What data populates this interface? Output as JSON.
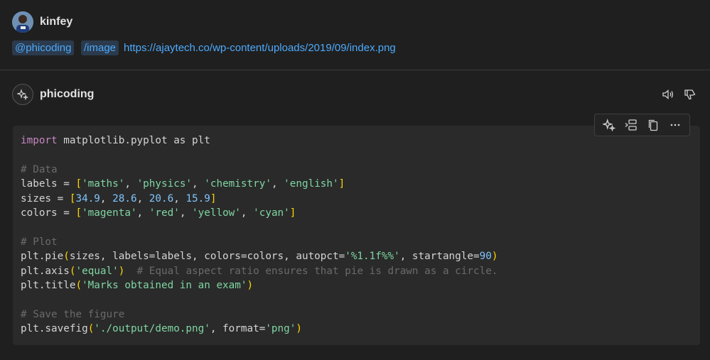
{
  "user_message": {
    "author": "kinfey",
    "agent_chip": "@phicoding",
    "command_chip": "/image",
    "url": "https://ajaytech.co/wp-content/uploads/2019/09/index.png"
  },
  "response": {
    "author": "phicoding",
    "code_lines": [
      "import matplotlib.pyplot as plt",
      "",
      "# Data",
      "labels = ['maths', 'physics', 'chemistry', 'english']",
      "sizes = [34.9, 28.6, 20.6, 15.9]",
      "colors = ['magenta', 'red', 'yellow', 'cyan']",
      "",
      "# Plot",
      "plt.pie(sizes, labels=labels, colors=colors, autopct='%1.1f%%', startangle=90)",
      "plt.axis('equal')  # Equal aspect ratio ensures that pie is drawn as a circle.",
      "plt.title('Marks obtained in an exam')",
      "",
      "# Save the figure",
      "plt.savefig('./output/demo.png', format='png')"
    ]
  },
  "icons": {
    "speaker": "speaker-icon",
    "thumbs_down": "thumbs-down-icon",
    "sparkle": "sparkle-icon",
    "insert": "insert-icon",
    "copy": "copy-icon",
    "more": "more-icon"
  },
  "colors": {
    "background": "#1f1f1f",
    "code_background": "#2a2a2a",
    "link": "#4daafc",
    "keyword": "#c586c0"
  }
}
